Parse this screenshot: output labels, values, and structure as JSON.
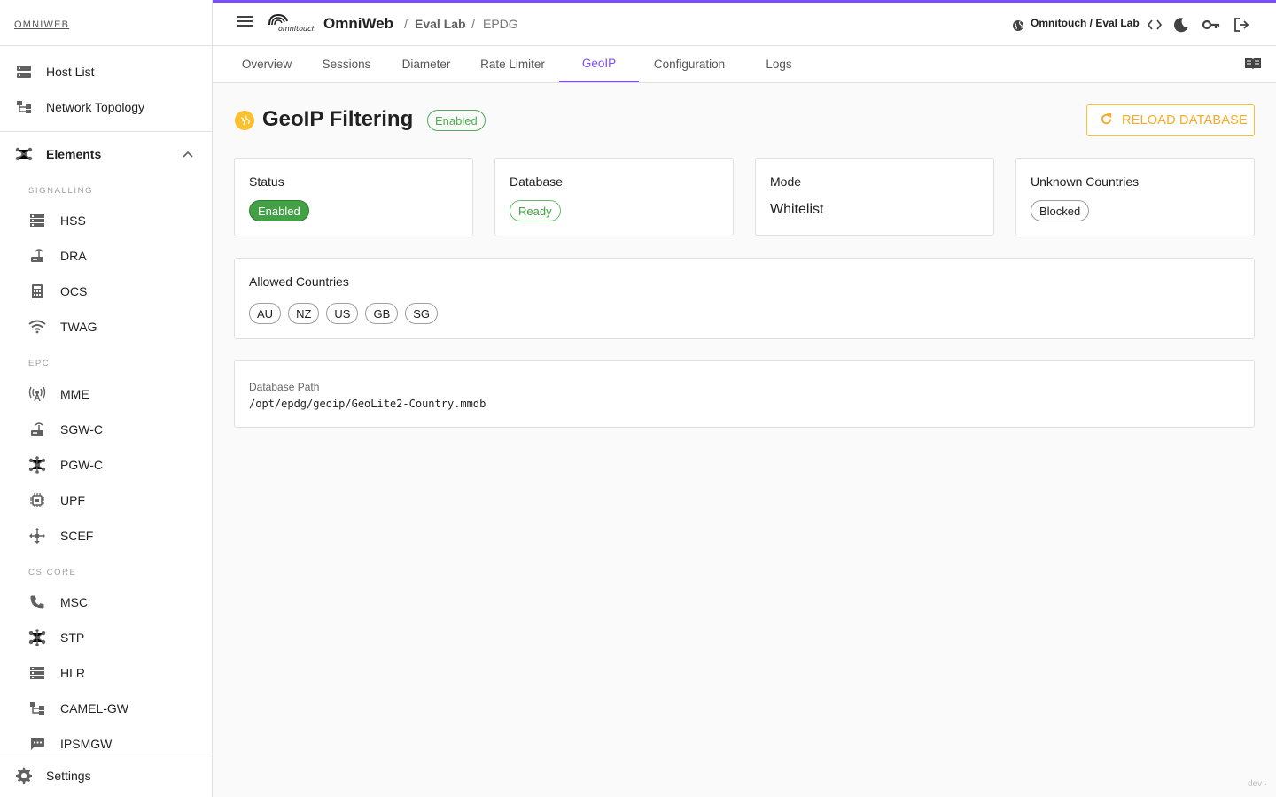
{
  "sidebar": {
    "brand": "OMNIWEB",
    "top_items": [
      {
        "label": "Host List",
        "icon": "server-list-icon"
      },
      {
        "label": "Network Topology",
        "icon": "topology-icon"
      }
    ],
    "elements_group": {
      "label": "Elements",
      "icon": "hub-icon",
      "expanded": true
    },
    "sections": {
      "signalling": "SIGNALLING",
      "epc": "EPC",
      "cs_core": "CS CORE"
    },
    "signalling_items": [
      {
        "label": "HSS",
        "icon": "storage-icon"
      },
      {
        "label": "DRA",
        "icon": "router-icon"
      },
      {
        "label": "OCS",
        "icon": "billing-icon"
      },
      {
        "label": "TWAG",
        "icon": "wifi-icon"
      }
    ],
    "epc_items": [
      {
        "label": "MME",
        "icon": "antenna-icon"
      },
      {
        "label": "SGW-C",
        "icon": "router-icon"
      },
      {
        "label": "PGW-C",
        "icon": "hub-icon"
      },
      {
        "label": "UPF",
        "icon": "chip-icon"
      },
      {
        "label": "SCEF",
        "icon": "arrows-icon"
      }
    ],
    "cs_items": [
      {
        "label": "MSC",
        "icon": "phone-icon"
      },
      {
        "label": "STP",
        "icon": "hub-icon"
      },
      {
        "label": "HLR",
        "icon": "storage-icon"
      },
      {
        "label": "CAMEL-GW",
        "icon": "topology-icon"
      },
      {
        "label": "IPSMGW",
        "icon": "sms-icon"
      }
    ],
    "settings": {
      "label": "Settings",
      "icon": "gear-icon"
    }
  },
  "topbar": {
    "app_name": "OmniWeb",
    "logo_text": "omnitouch",
    "crumb1": "Eval Lab",
    "crumb2": "EPDG",
    "separator": "/",
    "tenant": "Omnitouch / Eval Lab"
  },
  "tabs": [
    "Overview",
    "Sessions",
    "Diameter",
    "Rate Limiter",
    "GeoIP",
    "Configuration",
    "Logs"
  ],
  "active_tab": "GeoIP",
  "page": {
    "title": "GeoIP Filtering",
    "title_badge": "Enabled",
    "reload_button": "RELOAD DATABASE"
  },
  "cards": {
    "status": {
      "title": "Status",
      "value": "Enabled"
    },
    "database": {
      "title": "Database",
      "value": "Ready"
    },
    "mode": {
      "title": "Mode",
      "value": "Whitelist"
    },
    "unknown": {
      "title": "Unknown Countries",
      "value": "Blocked"
    }
  },
  "allowed": {
    "title": "Allowed Countries",
    "countries": [
      "AU",
      "NZ",
      "US",
      "GB",
      "SG"
    ]
  },
  "db_path": {
    "label": "Database Path",
    "value": "/opt/epdg/geoip/GeoLite2-Country.mmdb"
  },
  "footer": "dev ·",
  "colors": {
    "accent": "#7c4dff",
    "success": "#43a047",
    "warning": "#fbc02d"
  }
}
